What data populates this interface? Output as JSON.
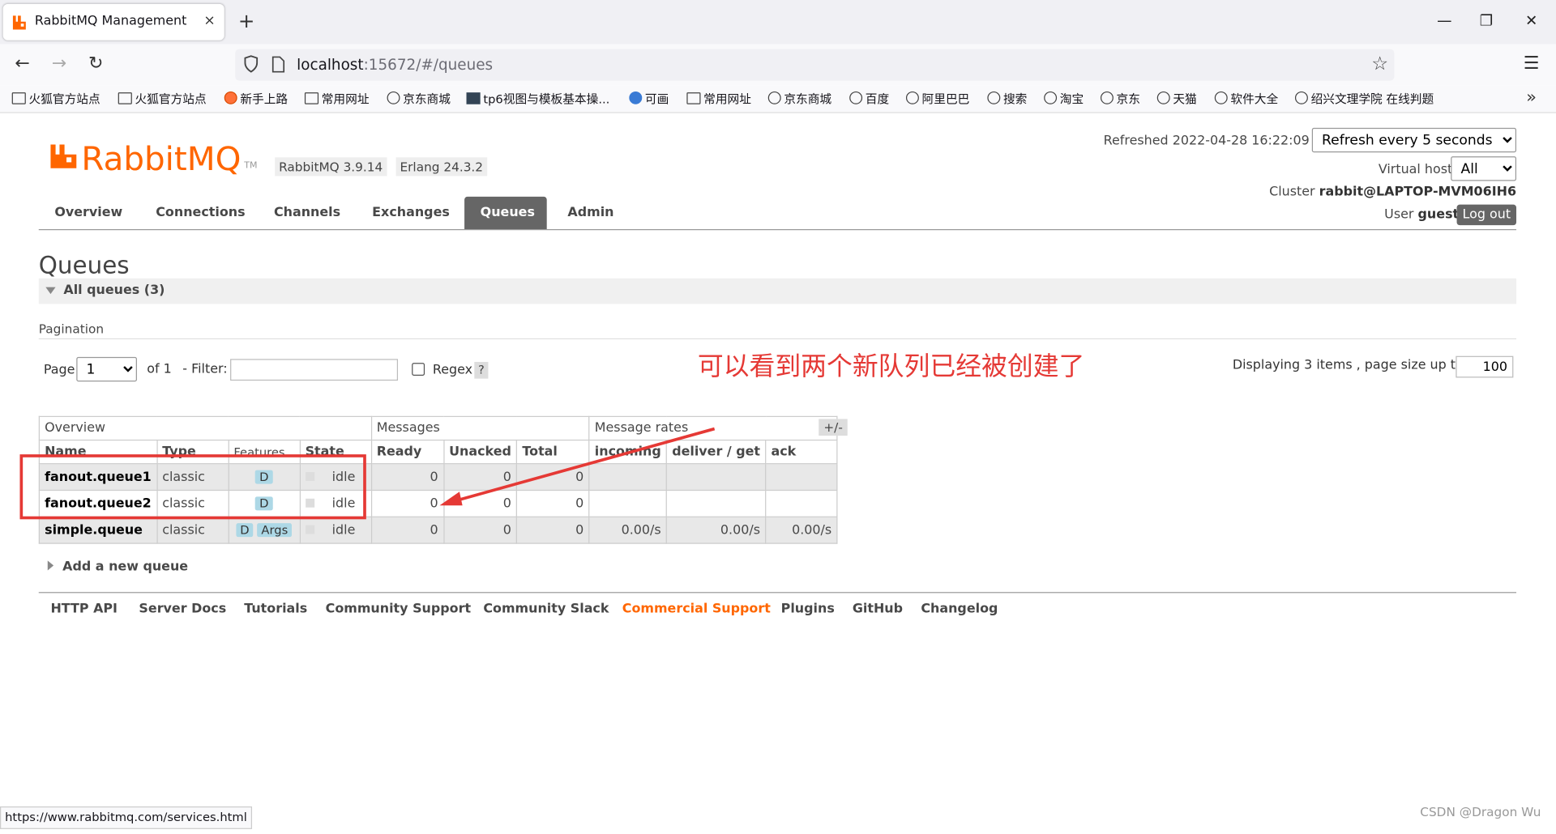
{
  "browser": {
    "tab_title": "RabbitMQ Management",
    "tab_close": "×",
    "new_tab": "+",
    "win_min": "—",
    "win_restore": "❐",
    "win_close": "✕",
    "url_host": "localhost",
    "url_rest": ":15672/#/queues",
    "status_url": "https://www.rabbitmq.com/services.html",
    "bookmarks": [
      "火狐官方站点",
      "火狐官方站点",
      "新手上路",
      "常用网址",
      "京东商城",
      "tp6视图与模板基本操...",
      "可画",
      "常用网址",
      "京东商城",
      "百度",
      "阿里巴巴",
      "搜索",
      "淘宝",
      "京东",
      "天猫",
      "软件大全",
      "绍兴文理学院 在线判题"
    ]
  },
  "header": {
    "logo": "RabbitMQ",
    "tm": "TM",
    "version": "RabbitMQ 3.9.14",
    "erlang": "Erlang 24.3.2",
    "refreshed": "Refreshed 2022-04-28 16:22:09",
    "refresh_option": "Refresh every 5 seconds",
    "vhost_label": "Virtual host",
    "vhost_value": "All",
    "cluster_label": "Cluster",
    "cluster_value": "rabbit@LAPTOP-MVM06IH6",
    "user_label": "User",
    "user_value": "guest",
    "logout": "Log out"
  },
  "nav": [
    "Overview",
    "Connections",
    "Channels",
    "Exchanges",
    "Queues",
    "Admin"
  ],
  "page": {
    "title": "Queues",
    "section": "All queues (3)",
    "pagination": "Pagination",
    "page_label": "Page",
    "page_value": "1",
    "of_label": "of 1",
    "filter_label": "- Filter:",
    "regex_label": "Regex",
    "help": "?",
    "displaying": "Displaying 3 items , page size up to:",
    "page_size": "100",
    "annotation": "可以看到两个新队列已经被创建了",
    "plusminus": "+/-",
    "add_queue": "Add a new queue"
  },
  "table": {
    "groups": [
      "Overview",
      "Messages",
      "Message rates"
    ],
    "columns": [
      "Name",
      "Type",
      "Features",
      "State",
      "Ready",
      "Unacked",
      "Total",
      "incoming",
      "deliver / get",
      "ack"
    ],
    "rows": [
      {
        "name": "fanout.queue1",
        "type": "classic",
        "feature": "D",
        "args": "",
        "state": "idle",
        "ready": "0",
        "unacked": "0",
        "total": "0",
        "incoming": "",
        "deliver": "",
        "ack": ""
      },
      {
        "name": "fanout.queue2",
        "type": "classic",
        "feature": "D",
        "args": "",
        "state": "idle",
        "ready": "0",
        "unacked": "0",
        "total": "0",
        "incoming": "",
        "deliver": "",
        "ack": ""
      },
      {
        "name": "simple.queue",
        "type": "classic",
        "feature": "D",
        "args": "Args",
        "state": "idle",
        "ready": "0",
        "unacked": "0",
        "total": "0",
        "incoming": "0.00/s",
        "deliver": "0.00/s",
        "ack": "0.00/s"
      }
    ]
  },
  "footer": [
    "HTTP API",
    "Server Docs",
    "Tutorials",
    "Community Support",
    "Community Slack",
    "Commercial Support",
    "Plugins",
    "GitHub",
    "Changelog"
  ],
  "watermark": "CSDN @Dragon   Wu",
  "colors": {
    "accent": "#ff6600",
    "annotation": "#e53935"
  }
}
